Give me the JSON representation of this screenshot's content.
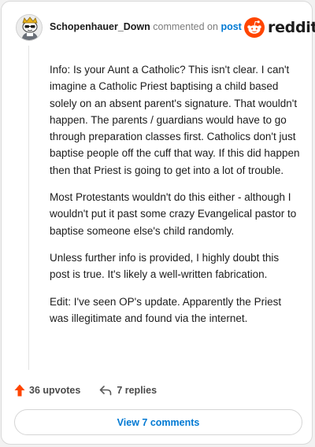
{
  "header": {
    "username": "Schopenhauer_Down",
    "commented_on": "commented on",
    "post_link": "post",
    "brand": "reddit"
  },
  "comment": {
    "paragraphs": [
      "Info: Is your Aunt a Catholic? This isn't clear. I can't imagine a Catholic Priest baptising a child based solely on an absent parent's signature. That wouldn't happen. The parents / guardians would have to go through preparation classes first. Catholics don't just baptise people off the cuff that way. If this did happen then that Priest is going to get into a lot of trouble.",
      "Most Protestants wouldn't do this either - although I wouldn't put it past some crazy Evangelical pastor to baptise someone else's child randomly.",
      "Unless further info is provided, I highly doubt this post is true. It's likely a well-written fabrication.",
      "Edit: I've seen OP's update. Apparently the Priest was illegitimate and found via the internet."
    ]
  },
  "actions": {
    "upvotes": "36 upvotes",
    "replies": "7 replies"
  },
  "view_button": "View 7 comments",
  "icons": {
    "avatar": "snoo-avatar-icon",
    "logo": "reddit-snoo-icon",
    "upvote": "upvote-arrow-icon",
    "reply": "reply-arrow-icon"
  },
  "colors": {
    "brand_orange": "#ff4500",
    "link_blue": "#0079d3",
    "upvote_orange": "#ff4500"
  }
}
